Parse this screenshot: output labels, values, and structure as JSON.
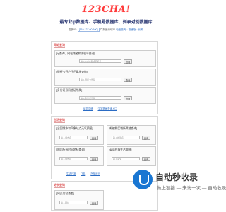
{
  "header": {
    "logo": "123CHA!",
    "tagline": "最专业ip数据库、手机号数据库、列表对别数据库",
    "ip_prefix": "您的IP:",
    "ip": "[119.127.60.100]",
    "ip_region": "广东省深圳市",
    "ip_links": "电信查询 · 极速版 · 长期"
  },
  "section1": {
    "title": "网站查询",
    "cards": [
      {
        "title": "[ip查询、网站域名和手机号查询]",
        "placeholder": "输入ip或域名或手机号",
        "button": "查询"
      },
      {
        "title": "[银行卡开户行归属地查询]",
        "placeholder": "输入银行卡号码",
        "button": "查询"
      },
      {
        "title": "[身份证号码验证所属]",
        "placeholder": "输入身份证号码",
        "button": "查询"
      }
    ],
    "links": [
      "域名注册",
      "汉字笔画查询入口"
    ]
  },
  "section2": {
    "title": "生活查询",
    "cards": [
      {
        "title": "[全国城市和气象站点天气预报]",
        "placeholder": "输入城市名",
        "button": "查询"
      },
      {
        "title": "[邮编和区域所属地查询]",
        "placeholder": "输入地区名",
        "button": "查询"
      },
      {
        "title": "[国内所有时间地标查询]",
        "placeholder": "输入城市名",
        "button": "查询"
      },
      {
        "title": "[英语在线生活翻译]",
        "placeholder": "输入英文",
        "button": "查询"
      }
    ],
    "links": [
      "生活日常",
      "飞机",
      "汽车出行"
    ]
  },
  "section3": {
    "title": "站长查询",
    "cards": [
      {
        "title": "[网页内容查看]",
        "placeholder": "输入网址",
        "button": "查询"
      }
    ]
  },
  "watermark": {
    "title": "自动秒收录",
    "subtitle": "做上链接 — 来访一次 — 自动收录"
  }
}
